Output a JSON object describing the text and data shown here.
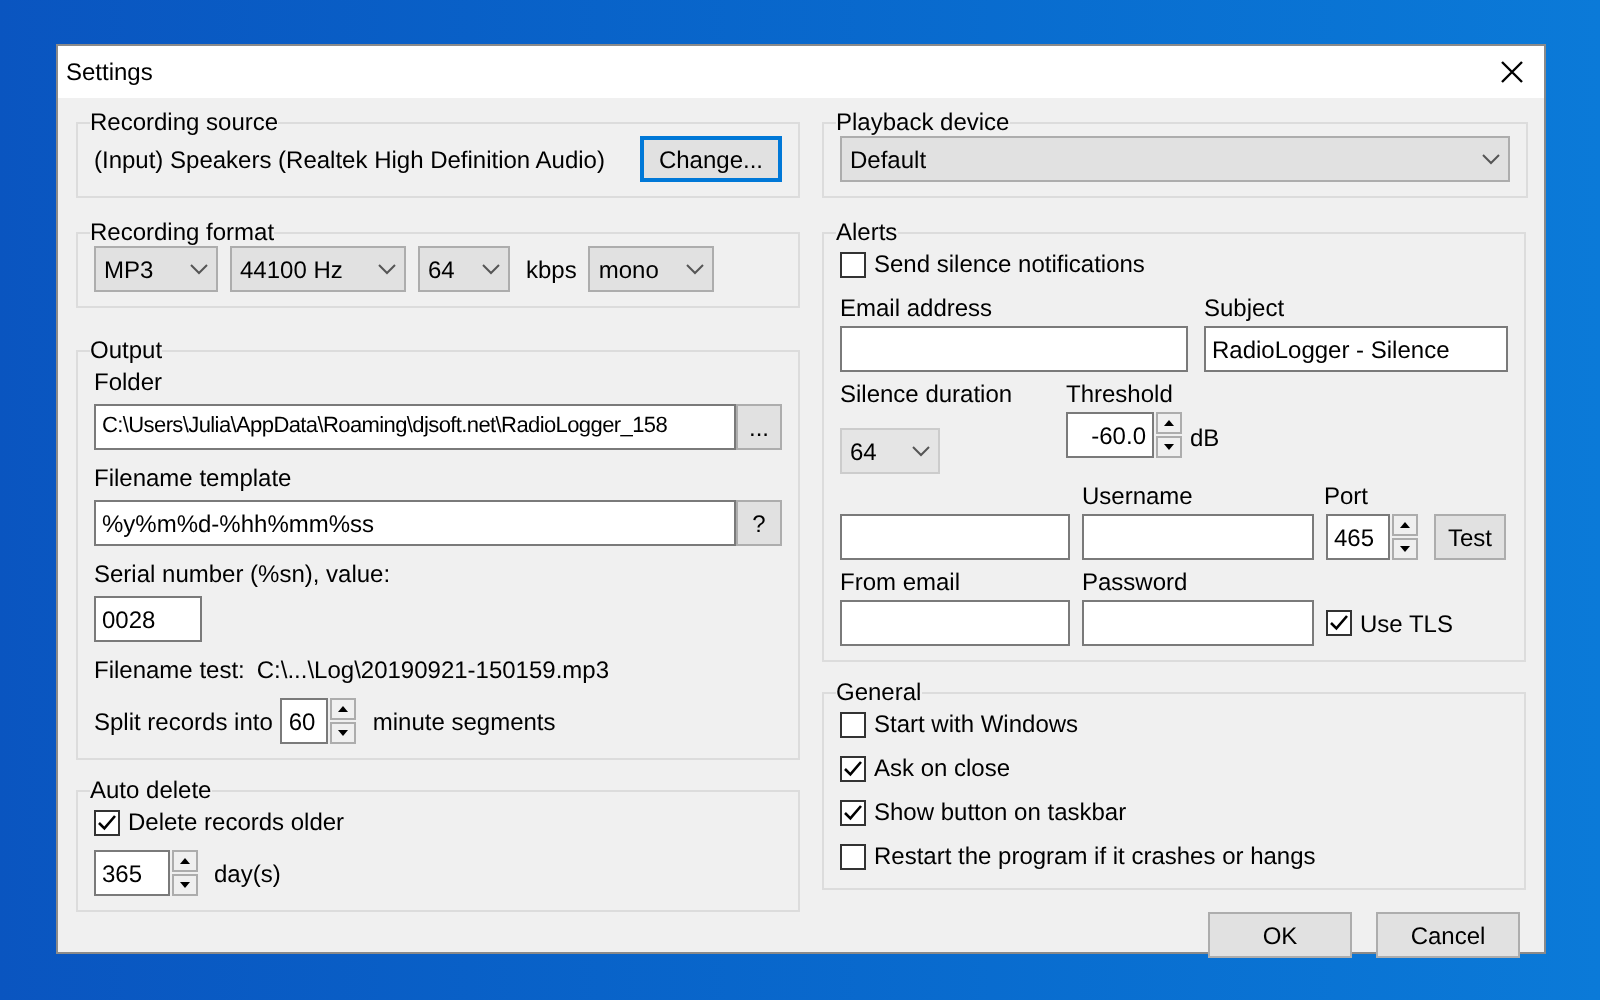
{
  "window": {
    "title": "Settings"
  },
  "recording_source": {
    "label": "Recording source",
    "device": "(Input) Speakers (Realtek High Definition Audio)",
    "button": "Change..."
  },
  "recording_format": {
    "label": "Recording format",
    "format": "MP3",
    "sample_rate": "44100 Hz",
    "bitrate": "64",
    "bitrate_unit": "kbps",
    "channels": "mono"
  },
  "output": {
    "label": "Output",
    "folder_label": "Folder",
    "folder": "C:\\Users\\Julia\\AppData\\Roaming\\djsoft.net\\RadioLogger_158",
    "browse_button": "...",
    "template_label": "Filename template",
    "template": "%y%m%d-%hh%mm%ss",
    "help_button": "?",
    "serial_label": "Serial number (%sn), value:",
    "serial": "0028",
    "test_label": "Filename test:",
    "test_value": "C:\\...\\Log\\20190921-150159.mp3",
    "split_label": "Split records into",
    "split": "60",
    "split_unit": "minute segments"
  },
  "auto_delete": {
    "label": "Auto delete",
    "checkbox": {
      "label": "Delete records older",
      "checked": true
    },
    "days": "365",
    "days_unit": "day(s)"
  },
  "playback_device": {
    "label": "Playback device",
    "value": "Default"
  },
  "alerts": {
    "label": "Alerts",
    "checkbox": {
      "label": "Send silence notifications",
      "checked": false
    },
    "email_label": "Email address",
    "subject_label": "Subject",
    "subject": "RadioLogger - Silence",
    "duration_label": "Silence duration",
    "duration": "64",
    "threshold_label": "Threshold",
    "threshold": "-60.0",
    "threshold_unit": "dB",
    "username_label": "Username",
    "port_label": "Port",
    "port": "465",
    "test_button": "Test",
    "from_label": "From email",
    "password_label": "Password",
    "tls": {
      "label": "Use TLS",
      "checked": true
    }
  },
  "general": {
    "label": "General",
    "options": [
      {
        "label": "Start with Windows",
        "checked": false
      },
      {
        "label": "Ask on close",
        "checked": true
      },
      {
        "label": "Show button on taskbar",
        "checked": true
      },
      {
        "label": "Restart the program if it crashes or hangs",
        "checked": false
      }
    ]
  },
  "buttons": [
    "OK",
    "Cancel"
  ]
}
